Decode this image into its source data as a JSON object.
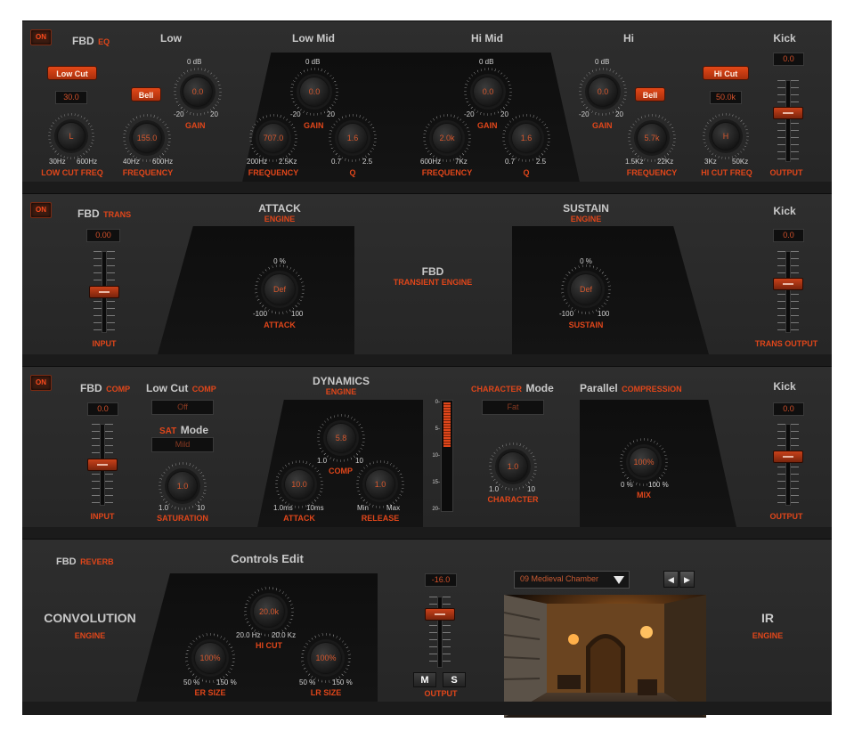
{
  "eq": {
    "on": "ON",
    "title_w": "FBD",
    "title_o": "EQ",
    "band_low": "Low",
    "band_lowmid": "Low Mid",
    "band_himid": "Hi Mid",
    "band_hi": "Hi",
    "band_kick": "Kick",
    "low_cut_btn": "Low Cut",
    "low_cut_value": "30.0",
    "low_cut_knob": "L",
    "low_cut_min": "30Hz",
    "low_cut_max": "600Hz",
    "low_cut_label": "LOW CUT FREQ",
    "low_bell": "Bell",
    "low_freq_value": "155.0",
    "low_freq_min": "40Hz",
    "low_freq_max": "600Hz",
    "low_freq_label": "FREQUENCY",
    "low_gain_top": "0 dB",
    "low_gain_value": "0.0",
    "low_gain_min": "-20",
    "low_gain_max": "20",
    "low_gain_label": "GAIN",
    "lm_gain_top": "0 dB",
    "lm_gain_value": "0.0",
    "lm_gain_min": "-20",
    "lm_gain_max": "20",
    "lm_gain_label": "GAIN",
    "lm_freq_value": "707.0",
    "lm_freq_min": "200Hz",
    "lm_freq_max": "2.5Kz",
    "lm_freq_label": "FREQUENCY",
    "lm_q_value": "1.6",
    "lm_q_min": "0.7",
    "lm_q_max": "2.5",
    "lm_q_label": "Q",
    "hm_gain_top": "0 dB",
    "hm_gain_value": "0.0",
    "hm_gain_min": "-20",
    "hm_gain_max": "20",
    "hm_gain_label": "GAIN",
    "hm_freq_value": "2.0k",
    "hm_freq_min": "600Hz",
    "hm_freq_max": "7Kz",
    "hm_freq_label": "FREQUENCY",
    "hm_q_value": "1.6",
    "hm_q_min": "0.7",
    "hm_q_max": "2.5",
    "hm_q_label": "Q",
    "hi_gain_top": "0 dB",
    "hi_gain_value": "0.0",
    "hi_gain_min": "-20",
    "hi_gain_max": "20",
    "hi_gain_label": "GAIN",
    "hi_bell": "Bell",
    "hi_freq_value": "5.7k",
    "hi_freq_min": "1.5Kz",
    "hi_freq_max": "22Kz",
    "hi_freq_label": "FREQUENCY",
    "hi_cut_btn": "Hi Cut",
    "hi_cut_value": "50.0k",
    "hi_cut_knob": "H",
    "hi_cut_min": "3Kz",
    "hi_cut_max": "50Kz",
    "hi_cut_label": "HI CUT FREQ",
    "output_value": "0.0",
    "output_label": "OUTPUT",
    "output_level": 0.62
  },
  "trans": {
    "on": "ON",
    "title_w": "FBD",
    "title_o": "TRANS",
    "input_value": "0.00",
    "input_label": "INPUT",
    "input_level": 0.5,
    "attack_title": "ATTACK",
    "attack_sub": "ENGINE",
    "attack_top": "0 %",
    "attack_value": "Def",
    "attack_min": "-100",
    "attack_max": "100",
    "attack_label": "ATTACK",
    "center_title": "FBD",
    "center_sub": "TRANSIENT ENGINE",
    "sustain_title": "SUSTAIN",
    "sustain_sub": "ENGINE",
    "sustain_top": "0 %",
    "sustain_value": "Def",
    "sustain_min": "-100",
    "sustain_max": "100",
    "sustain_label": "SUSTAIN",
    "kick": "Kick",
    "output_value": "0.0",
    "output_label": "TRANS OUTPUT",
    "output_level": 0.62
  },
  "comp": {
    "on": "ON",
    "title_w": "FBD",
    "title_o": "COMP",
    "input_value": "0.0",
    "input_label": "INPUT",
    "input_level": 0.5,
    "lowcut_w": "Low Cut",
    "lowcut_o": "COMP",
    "lowcut_value": "Off",
    "sat_o": "SAT",
    "sat_w": "Mode",
    "sat_value": "Mild",
    "saturation_value": "1.0",
    "saturation_min": "1.0",
    "saturation_max": "10",
    "saturation_label": "SATURATION",
    "dyn_title": "DYNAMICS",
    "dyn_sub": "ENGINE",
    "comp_value": "5.8",
    "comp_min": "1.0",
    "comp_max": "10",
    "comp_label": "COMP",
    "attack_value": "10.0",
    "attack_min": "1.0ms",
    "attack_max": "10ms",
    "attack_label": "ATTACK",
    "release_value": "1.0",
    "release_min": "Min",
    "release_max": "Max",
    "release_label": "RELEASE",
    "meter_ticks": [
      "0-",
      "5-",
      "10-",
      "15-",
      "20-"
    ],
    "meter_level": 0.42,
    "char_o": "CHARACTER",
    "char_w": "Mode",
    "char_mode_value": "Fat",
    "character_value": "1.0",
    "character_min": "1.0",
    "character_max": "10",
    "character_label": "CHARACTER",
    "parallel_w": "Parallel",
    "parallel_o": "COMPRESSION",
    "mix_value": "100%",
    "mix_min": "0 %",
    "mix_max": "100 %",
    "mix_label": "MIX",
    "kick": "Kick",
    "output_value": "0.0",
    "output_label": "OUTPUT",
    "output_level": 0.62
  },
  "reverb": {
    "title_w": "FBD",
    "title_o": "REVERB",
    "controls_edit": "Controls Edit",
    "conv_title": "CONVOLUTION",
    "conv_sub": "ENGINE",
    "hicut_value": "20.0k",
    "hicut_min": "20.0 Hz",
    "hicut_max": "20.0 Kz",
    "hicut_label": "HI CUT",
    "er_value": "100%",
    "er_min": "50 %",
    "er_max": "150 %",
    "er_label": "ER SIZE",
    "lr_value": "100%",
    "lr_min": "50 %",
    "lr_max": "150 %",
    "lr_label": "LR SIZE",
    "output_value": "-16.0",
    "output_label": "OUTPUT",
    "output_level": 0.8,
    "mute": "M",
    "solo": "S",
    "preset": "09 Medieval Chamber",
    "prev": "◀",
    "next": "▶",
    "ir_title": "IR",
    "ir_sub": "ENGINE"
  },
  "colors": {
    "accent": "#e0461a",
    "knob_arc": "#c9481e",
    "panel": "#2b2b2b",
    "text": "#c9c9c9"
  }
}
